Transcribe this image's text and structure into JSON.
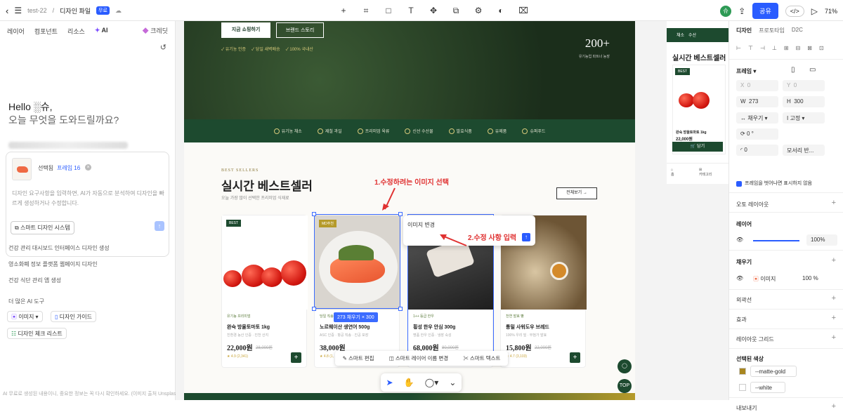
{
  "topbar": {
    "project": "test-22",
    "separator": "/",
    "file": "디자인 파일",
    "badge": "무료",
    "share": "공유",
    "code": "</>",
    "zoom": "71%"
  },
  "left_panel": {
    "tabs": [
      "레이어",
      "컴포넌트",
      "리소스",
      "AI"
    ],
    "credit": "크레딧",
    "greeting1": "Hello ░슈,",
    "greeting2": "오늘 무엇을 도와드릴까요?",
    "selected_label": "선택됨",
    "selected_frame": "프레임 16",
    "placeholder": "디자인 요구사항을 입력하면, AI가 자동으로 분석하여 디자인을 빠르게 생성하거나 수정합니다.",
    "smart_system": "스마트 디자인 시스템",
    "suggestions": [
      "건강 관리 대시보드 인터페이스 디자인 생성",
      "영소화폐 정보 플랫폼 웹페이지 디자인",
      "건강 식단 관리 앱 생성"
    ],
    "more_tools": "더 많은 AI 도구",
    "chips": [
      "이미지",
      "디자인 가이드",
      "디자인 체크 리스트"
    ],
    "disclaimer": "AI 무료로 생성된 내용이니, 중요한 정보는 꼭 다시 확인하세요. (이미지 출처 Unsplash)"
  },
  "site": {
    "hero_btn1": "지금 쇼핑하기",
    "hero_btn2": "브랜드 스토리",
    "hero_checks": [
      "✓ 유기농 인증",
      "✓ 당일 새벽배송",
      "✓ 100% 국내산"
    ],
    "hero_num": "200+",
    "hero_num_label": "유기농업 파트너 농장",
    "categories": [
      "유기농 채소",
      "제철 과일",
      "프리미엄 육류",
      "신선 수산물",
      "발효식품",
      "유제품",
      "슈퍼푸드"
    ],
    "bs_sub": "BEST SELLERS",
    "bs_title": "실시간 베스트셀러",
    "bs_desc": "오늘 가장 많이 선택한 프리미엄 식재료",
    "view_all": "전체보기 →",
    "products": [
      {
        "badge": "BEST",
        "tag": "유기농 프리미엄",
        "name": "완숙 방울토마토 1kg",
        "desc": "친환경 농산 인증 · 진천 산지",
        "price": "22,000원",
        "old": "28,000원",
        "rating": "★ 4.9 (2,341)"
      },
      {
        "badge": "MD추천",
        "tag": "당일 직송 · 신선",
        "name": "노르웨이산 생연어 500g",
        "desc": "ASC 인증 · 항공 직송 · 진공 포장",
        "price": "38,000원",
        "old": "",
        "rating": "★ 4.8 (1,"
      },
      {
        "badge": "",
        "tag": "1++ 등급 한우",
        "name": "횡성 한우 안심 300g",
        "desc": "명품 한우 인증 · 냉장 숙성",
        "price": "68,000원",
        "old": "80,000원",
        "rating": ""
      },
      {
        "badge": "",
        "tag": "천연 발효 빵",
        "name": "통밀 사워도우 브레드",
        "desc": "100% 우리 밀 · 무첨가 발효",
        "price": "15,800원",
        "old": "22,000원",
        "rating": "★ 4.7 (3,103)"
      }
    ],
    "dimension": "273 채우기 × 300",
    "edit_popup": "이미지 변경",
    "anno1": "1.수정하려는 이미지 선택",
    "anno2": "2.수정 사항 입력",
    "context_bar": [
      "스마트 편집",
      "스마트 레이어 이름 변경",
      "스마트 텍스트"
    ],
    "fab_top": "TOP",
    "mobile": {
      "tabs": [
        "채소",
        "수산"
      ],
      "title": "실시간 베스트셀러",
      "badge": "BEST",
      "name": "완숙 방울토마토 1kg",
      "price": "22,000원",
      "btn": "담기",
      "nav": [
        "홈",
        "카테고리"
      ]
    }
  },
  "right_panel": {
    "tabs": [
      "디자인",
      "프로토타입",
      "D2C"
    ],
    "frame": "프레임",
    "x": "0",
    "y": "0",
    "w": "273",
    "h": "300",
    "fill_mode": "채우기",
    "fixed": "고정",
    "rotation": "0 °",
    "radius": "0",
    "corner": "모서리 반...",
    "clip": "프레임을 벗어나면 표시하지 않음",
    "auto_layout": "오토 레이아웃",
    "layer": "레이어",
    "opacity": "100%",
    "fill": "채우기",
    "fill_type": "이미지",
    "fill_pct": "100 %",
    "stroke": "외곽선",
    "effects": "효과",
    "grid": "레이아웃 그리드",
    "sel_colors": "선택된 색상",
    "colors": [
      {
        "name": "--matte-gold",
        "hex": "#a8861f"
      },
      {
        "name": "--white",
        "hex": "#ffffff"
      }
    ],
    "export": "내보내기"
  }
}
